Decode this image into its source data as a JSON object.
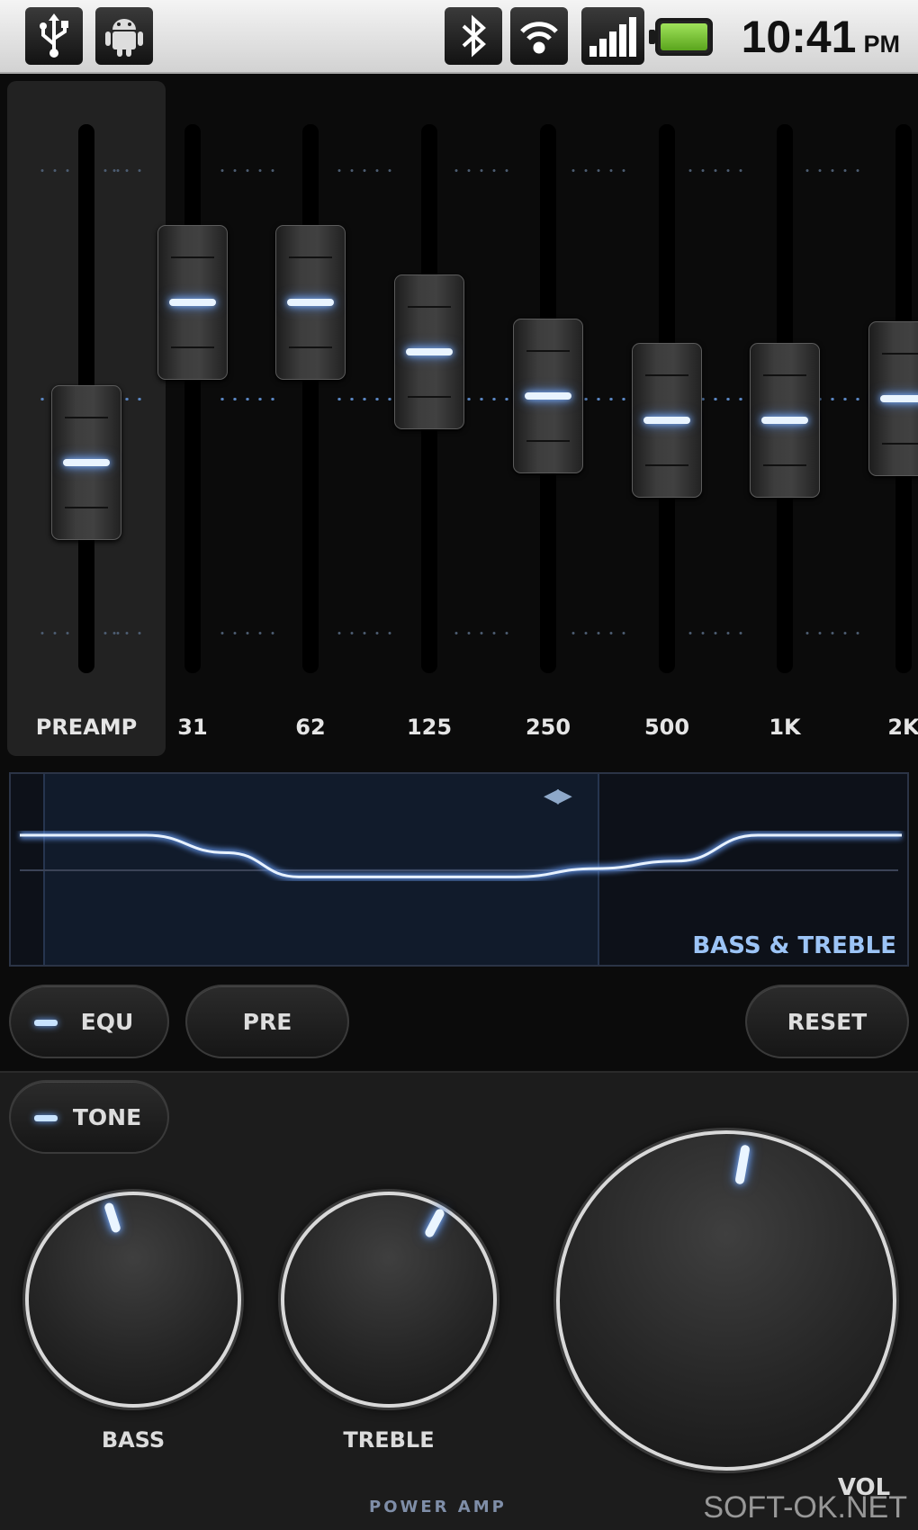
{
  "status_bar": {
    "left_icons": [
      "usb-icon",
      "android-icon"
    ],
    "right_icons": [
      "bluetooth-icon",
      "wifi-icon",
      "signal-icon",
      "battery-icon"
    ],
    "battery_color": "#7cc33a",
    "time": "10:41",
    "ampm": "PM"
  },
  "equalizer": {
    "preamp": {
      "label": "PREAMP",
      "level": -0.27
    },
    "bands": [
      {
        "label": "31",
        "level": 0.41
      },
      {
        "label": "62",
        "level": 0.41
      },
      {
        "label": "125",
        "level": 0.2
      },
      {
        "label": "250",
        "level": 0.01
      },
      {
        "label": "500",
        "level": -0.09
      },
      {
        "label": "1K",
        "level": -0.09
      },
      {
        "label": "2K",
        "level": 0.0
      }
    ],
    "accent_color": "#7fb2ff"
  },
  "graph": {
    "title": "BASS & TREBLE",
    "arrows": "◀▶"
  },
  "buttons": {
    "equ": "EQU",
    "pre": "PRE",
    "reset": "RESET",
    "tone": "TONE"
  },
  "tone": {
    "bass_label": "BASS",
    "treble_label": "TREBLE",
    "vol_label": "VOL"
  },
  "brand": "POWER AMP",
  "watermark": "SOFT-OK.NET"
}
